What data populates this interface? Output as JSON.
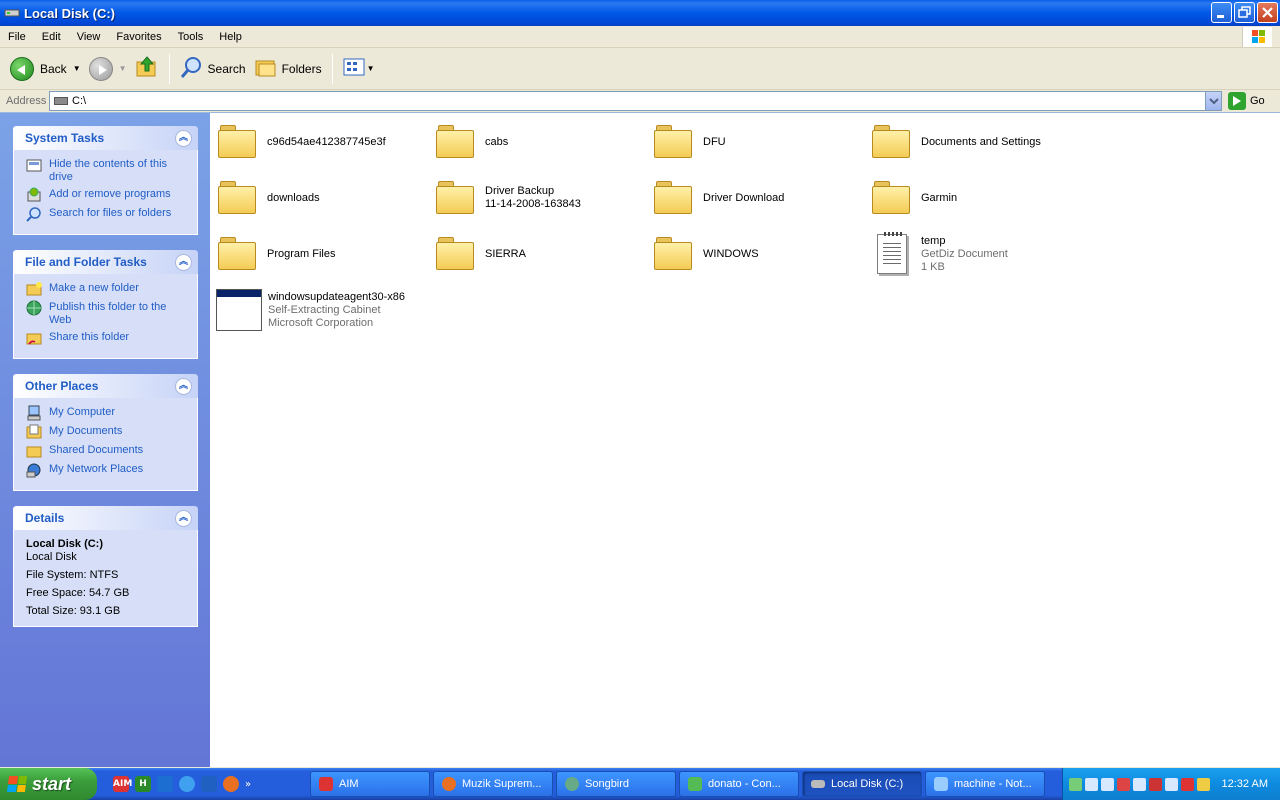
{
  "window": {
    "title": "Local Disk (C:)"
  },
  "menu": [
    "File",
    "Edit",
    "View",
    "Favorites",
    "Tools",
    "Help"
  ],
  "toolbar": {
    "back_label": "Back",
    "search_label": "Search",
    "folders_label": "Folders"
  },
  "address": {
    "label": "Address",
    "value": "C:\\",
    "go_label": "Go"
  },
  "system_tasks": {
    "title": "System Tasks",
    "items": [
      "Hide the contents of this drive",
      "Add or remove programs",
      "Search for files or folders"
    ]
  },
  "file_folder_tasks": {
    "title": "File and Folder Tasks",
    "items": [
      "Make a new folder",
      "Publish this folder to the Web",
      "Share this folder"
    ]
  },
  "other_places": {
    "title": "Other Places",
    "items": [
      "My Computer",
      "My Documents",
      "Shared Documents",
      "My Network Places"
    ]
  },
  "details": {
    "title": "Details",
    "name": "Local Disk (C:)",
    "type": "Local Disk",
    "file_system": "File System: NTFS",
    "free_space": "Free Space: 54.7 GB",
    "total_size": "Total Size: 93.1 GB"
  },
  "files": [
    {
      "name": "c96d54ae412387745e3f",
      "kind": "folder"
    },
    {
      "name": "cabs",
      "kind": "folder"
    },
    {
      "name": "DFU",
      "kind": "folder"
    },
    {
      "name": "Documents and Settings",
      "kind": "folder"
    },
    {
      "name": "downloads",
      "kind": "folder"
    },
    {
      "name": "Driver Backup",
      "line2": "11-14-2008-163843",
      "kind": "folder"
    },
    {
      "name": "Driver Download",
      "kind": "folder"
    },
    {
      "name": "Garmin",
      "kind": "folder"
    },
    {
      "name": "Program Files",
      "kind": "folder"
    },
    {
      "name": "SIERRA",
      "kind": "folder"
    },
    {
      "name": "WINDOWS",
      "kind": "folder"
    },
    {
      "name": "temp",
      "line2": "GetDiz Document",
      "line3": "1 KB",
      "kind": "document"
    },
    {
      "name": "windowsupdateagent30-x86",
      "line2": "Self-Extracting Cabinet",
      "line3": "Microsoft Corporation",
      "kind": "executable"
    }
  ],
  "taskbar": {
    "start_label": "start",
    "quicklaunch": [
      "AIM",
      "H"
    ],
    "tasks": [
      "AIM",
      "Muzik Suprem...",
      "Songbird",
      "donato - Con...",
      "Local Disk (C:)",
      "machine - Not..."
    ],
    "active_task": "Local Disk (C:)",
    "clock": "12:32 AM"
  },
  "colors": {
    "titlebar": "#0058E6",
    "task_link": "#215DC6",
    "taskbar": "#245EDC",
    "start_button": "#3B9E3B"
  }
}
